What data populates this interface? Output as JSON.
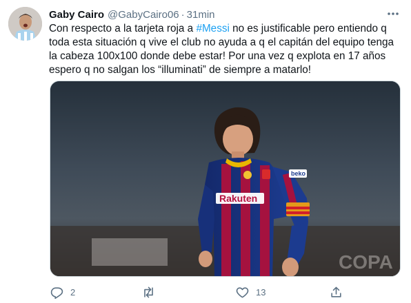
{
  "tweet": {
    "author_name": "Gaby Cairo",
    "author_handle": "@GabyCairo06",
    "separator": "·",
    "time": "31min",
    "text_before_hashtag": "Con respecto a la tarjeta roja a ",
    "hashtag": "#Messi",
    "text_after_hashtag": " no es justificable pero entiendo q toda esta situación q vive el club no ayuda a q el capitán del equipo tenga la cabeza 100x100 donde debe estar! Por una vez q explota en 17 años espero q no salgan los “illuminati” de siempre a matarlo!"
  },
  "media": {
    "armband_text": "beko",
    "shirt_sponsor": "Rakuten",
    "background_text": "COPA"
  },
  "actions": {
    "reply_count": "2",
    "retweet_count": "",
    "like_count": "13"
  },
  "colors": {
    "link": "#1da1f2",
    "secondary_text": "#5b7083",
    "primary_text": "#0f1419"
  },
  "icons": {
    "more": "more-icon",
    "reply": "reply-icon",
    "retweet": "retweet-icon",
    "like": "heart-icon",
    "share": "share-icon"
  }
}
